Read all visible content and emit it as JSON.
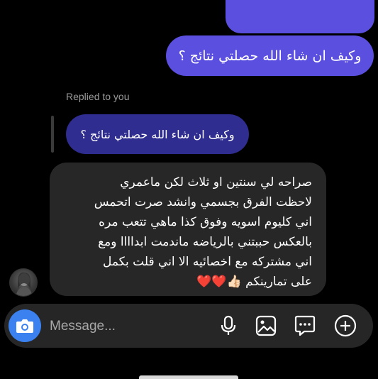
{
  "thread": {
    "sent_message": "وكيف ان شاء الله حصلتي نتائج ؟",
    "replied_label": "Replied to you",
    "quoted_message": "وكيف ان شاء الله حصلتي نتائج ؟",
    "received_lines": [
      "صراحه لي سنتين او ثلاث لكن ماعمري",
      "لاحظت الفرق بجسمي وانشد صرت اتحمس",
      "اني كليوم اسويه وفوق كذا ماهي تتعب مره",
      "بالعكس حببتني بالرياضه ماندمت ابداااا ومع",
      "اني مشتركه مع اخصائيه الا اني قلت بكمل",
      "على تمارينكم 👍🏻❤️❤️"
    ]
  },
  "composer": {
    "placeholder": "Message...",
    "icons": [
      "camera-icon",
      "microphone-icon",
      "gallery-icon",
      "sticker-icon",
      "plus-icon"
    ]
  },
  "colors": {
    "sent_bubble": "#5b4fe0",
    "quoted_bubble": "#2f2d8f",
    "received_bubble": "#272727",
    "camera_button": "#3b82f0"
  }
}
